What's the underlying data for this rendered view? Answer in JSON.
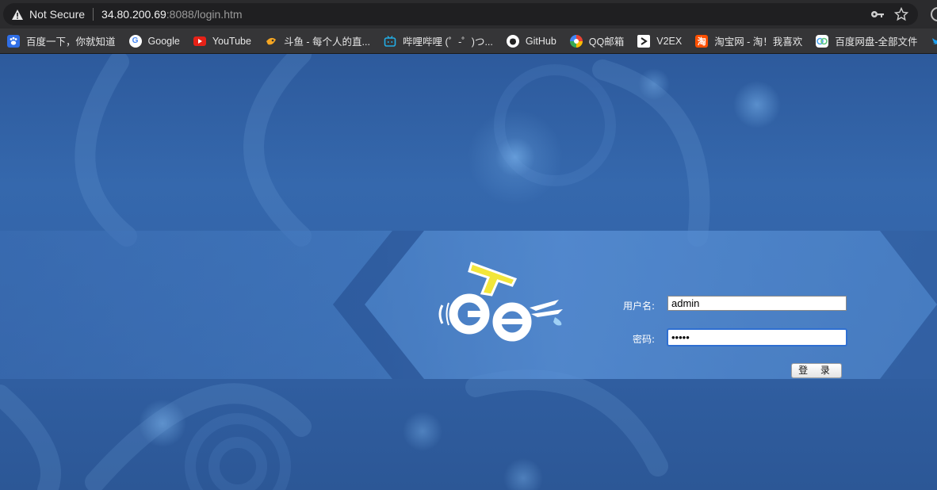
{
  "browser": {
    "security_label": "Not Secure",
    "url_host": "34.80.200.69",
    "url_rest": ":8088/login.htm"
  },
  "bookmarks": [
    {
      "label": "百度一下，你就知道",
      "icon": "baidu-paw-icon",
      "color": "#2f6ee6"
    },
    {
      "label": "Google",
      "icon": "google-g-icon",
      "color": "#ffffff"
    },
    {
      "label": "YouTube",
      "icon": "youtube-play-icon",
      "color": "#e62117"
    },
    {
      "label": "斗鱼 - 每个人的直...",
      "icon": "douyu-fish-icon",
      "color": "#f5a623"
    },
    {
      "label": "哔哩哔哩 (゜-゜)つ...",
      "icon": "bilibili-tv-icon",
      "color": "#23ade5"
    },
    {
      "label": "GitHub",
      "icon": "github-cat-icon",
      "color": "#ffffff"
    },
    {
      "label": "QQ邮箱",
      "icon": "qqmail-icon",
      "color": "#f2b705"
    },
    {
      "label": "V2EX",
      "icon": "v2ex-icon",
      "color": "#ffffff"
    },
    {
      "label": "淘宝网 - 淘！我喜欢",
      "icon": "taobao-icon",
      "color": "#ff5000"
    },
    {
      "label": "百度网盘-全部文件",
      "icon": "baidu-pan-icon",
      "color": "#4aa3f0"
    },
    {
      "label": "",
      "icon": "twitter-bird-icon",
      "color": "#1da1f2"
    }
  ],
  "login": {
    "username_label": "用户名:",
    "username_value": "admin",
    "password_label": "密码:",
    "password_value": "•••••",
    "submit_label": "登 录"
  },
  "colors": {
    "page_bg": "#2f5d9f",
    "logo_yellow": "#f2e63a",
    "input_focus": "#2f6fd1"
  }
}
